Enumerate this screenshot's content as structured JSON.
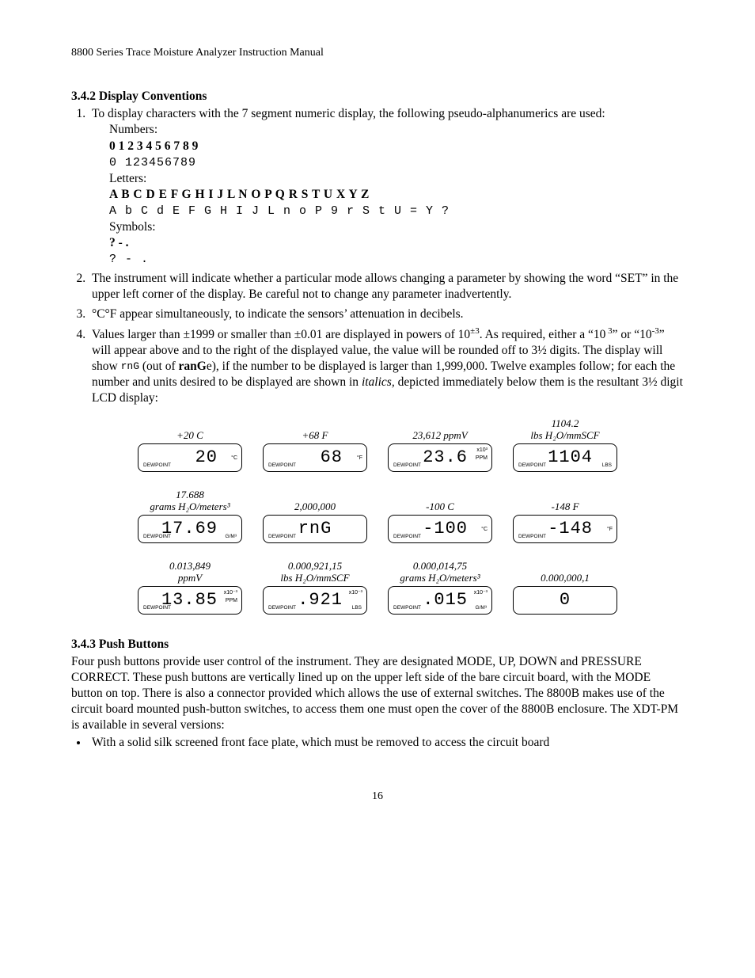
{
  "runningHead": "8800 Series Trace Moisture Analyzer Instruction Manual",
  "sec342": {
    "heading": "3.4.2 Display Conventions",
    "item1_lead": "To display characters with the 7 segment numeric display, the following pseudo-alphanumerics are used:",
    "numbers_label": "Numbers:",
    "numbers_bold": "0  1 2 3 4 5 6 7 8 9",
    "numbers_seg": "0 123456789",
    "letters_label": "Letters:",
    "letters_bold": "A B C D E F G H  I J  L N O P Q R S  T U X Y Z",
    "letters_seg": "A b C d E F G H I J L n o P 9 r S t U = Y ?",
    "symbols_label": "Symbols:",
    "symbols_bold": "?   -  .",
    "symbols_seg": "?  - .",
    "item2": "The instrument will indicate whether a particular mode allows changing a parameter by showing the word “SET” in the upper left corner of the display. Be careful not to change any parameter inadvertently.",
    "item3": "°C°F appear simultaneously, to indicate the sensors’ attenuation in decibels.",
    "item4_a": "Values larger than ±1999 or smaller than ±0.01 are displayed in powers of 10",
    "item4_b": ". As required, either a “10",
    "item4_c": "” or “10",
    "item4_d": "” will appear above and to the right of the displayed value, the value will be rounded off to 3½ digits. The display will show ",
    "item4_e": " (out of ",
    "item4_f": "e), if the number to be displayed is larger than 1,999,000. Twelve examples follow; for each the number and units desired to be displayed are shown in ",
    "italics_word": "italics,",
    "item4_g": " depicted immediately below them is the resultant 3½ digit LCD display:",
    "pm3": "±3",
    "sup3": " 3",
    "supm3": "-3",
    "rnG_seg": "rnG",
    "ranG_word": "ranG"
  },
  "grid": [
    {
      "cap1": "+20 C",
      "cap2": "",
      "val": "20",
      "unit": "°C",
      "exp": "",
      "dew": "DEWPOINT",
      "rlbl": ""
    },
    {
      "cap1": "+68 F",
      "cap2": "",
      "val": "68",
      "unit": "°F",
      "exp": "",
      "dew": "DEWPOINT",
      "rlbl": ""
    },
    {
      "cap1": "23,612 ppmV",
      "cap2": "",
      "val": "23.6",
      "unit": "PPM",
      "exp": "x10³",
      "dew": "DEWPOINT",
      "rlbl": ""
    },
    {
      "cap1": "1104.2",
      "cap2": "lbs H₂O/mmSCF",
      "val": "1104",
      "unit": "",
      "exp": "",
      "dew": "DEWPOINT",
      "rlbl": "LBS"
    },
    {
      "cap1": "17.688",
      "cap2": "grams H₂O/meters³",
      "val": "17.69",
      "unit": "",
      "exp": "",
      "dew": "DEWPOINT",
      "rlbl": "G/M³"
    },
    {
      "cap1": "2,000,000",
      "cap2": "",
      "val": "rnG",
      "unit": "",
      "exp": "",
      "dew": "DEWPOINT",
      "rlbl": ""
    },
    {
      "cap1": "-100 C",
      "cap2": "",
      "val": "-100",
      "unit": "°C",
      "exp": "",
      "dew": "DEWPOINT",
      "rlbl": ""
    },
    {
      "cap1": "-148 F",
      "cap2": "",
      "val": "-148",
      "unit": "°F",
      "exp": "",
      "dew": "DEWPOINT",
      "rlbl": ""
    },
    {
      "cap1": "0.013,849",
      "cap2": "ppmV",
      "val": "13.85",
      "unit": "PPM",
      "exp": "x10⁻³",
      "dew": "DEWPOINT",
      "rlbl": ""
    },
    {
      "cap1": "0.000,921,15",
      "cap2": "lbs H₂O/mmSCF",
      "val": ".921",
      "unit": "",
      "exp": "x10⁻³",
      "dew": "DEWPOINT",
      "rlbl": "LBS"
    },
    {
      "cap1": "0.000,014,75",
      "cap2": "grams H₂O/meters³",
      "val": ".015",
      "unit": "",
      "exp": "x10⁻³",
      "dew": "DEWPOINT",
      "rlbl": "G/M³"
    },
    {
      "cap1": "0.000,000,1",
      "cap2": "",
      "val": "0",
      "unit": "",
      "exp": "",
      "dew": "",
      "rlbl": ""
    }
  ],
  "sec343": {
    "heading": "3.4.3 Push Buttons",
    "para": "Four push buttons provide user control of the instrument. They are designated MODE, UP, DOWN and PRESSURE CORRECT. These push buttons are vertically lined up on the upper left side of the bare circuit board, with the MODE button on top. There is also a connector provided which allows the use of external switches. The 8800B makes use of the circuit board mounted push-button switches, to access them one must open the cover of the 8800B enclosure. The XDT-PM is available in several versions:",
    "bullet1": "With a solid silk screened front face plate, which must be removed to access the circuit board"
  },
  "pageNum": "16"
}
